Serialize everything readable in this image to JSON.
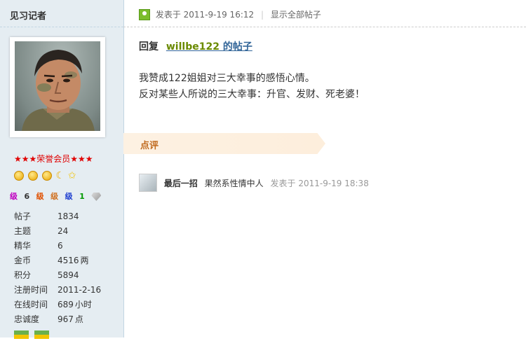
{
  "user": {
    "name": "见习记者",
    "rank_title": "★★★荣誉会员★★★",
    "level_labels": [
      "级",
      "6",
      "级",
      "级",
      "级",
      "1"
    ],
    "stats": [
      {
        "label": "帖子",
        "value": "1834",
        "unit": ""
      },
      {
        "label": "主题",
        "value": "24",
        "unit": ""
      },
      {
        "label": "精华",
        "value": "6",
        "unit": ""
      },
      {
        "label": "金币",
        "value": "4516",
        "unit": "两"
      },
      {
        "label": "积分",
        "value": "5894",
        "unit": ""
      },
      {
        "label": "注册时间",
        "value": "2011-2-16",
        "unit": ""
      },
      {
        "label": "在线时间",
        "value": "689",
        "unit": "小时"
      },
      {
        "label": "忠诚度",
        "value": "967",
        "unit": "点"
      }
    ]
  },
  "post": {
    "time_text": "发表于 2011-9-19 16:12",
    "separator": "|",
    "show_all": "显示全部帖子",
    "reply_prefix": "回复",
    "reply_user": "willbe122",
    "reply_suffix": " 的帖子",
    "content_lines": [
      "我赞成122姐姐对三大幸事的感悟心情。",
      "反对某些人所说的三大幸事：升官、发财、死老婆！"
    ]
  },
  "comment": {
    "section_label": "点评",
    "user": "最后一招",
    "text": "果然系性情中人",
    "time_text": "发表于 2011-9-19 18:38"
  },
  "colors": {
    "sidebar_bg": "#e5edf2",
    "rank_red": "#e00000",
    "link_blue": "#336699",
    "comment_orange": "#c06a1e"
  }
}
